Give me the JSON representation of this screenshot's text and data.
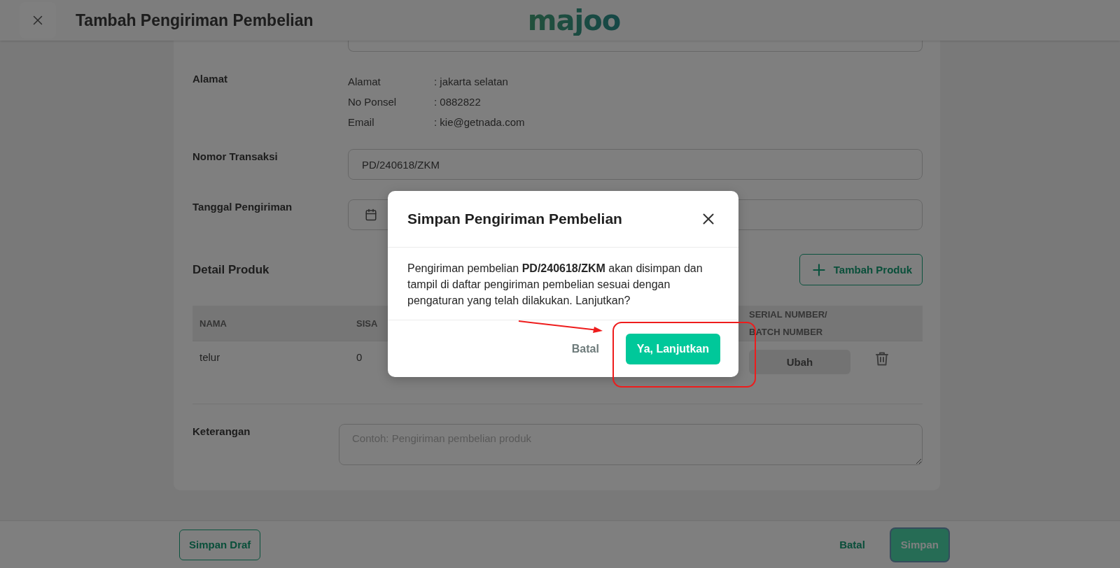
{
  "header": {
    "title": "Tambah Pengiriman Pembelian",
    "logo": "majoo"
  },
  "form": {
    "rows": [
      {
        "kind": "info",
        "label": "Alamat",
        "lines": [
          {
            "name": "Alamat",
            "value": ": jakarta selatan"
          },
          {
            "name": "No Ponsel",
            "value": ": 0882822"
          },
          {
            "name": "Email",
            "value": ": kie@getnada.com"
          }
        ]
      },
      {
        "kind": "input",
        "label": "Nomor Transaksi",
        "value": "PD/240618/ZKM"
      },
      {
        "kind": "date",
        "label": "Tanggal Pengiriman"
      }
    ]
  },
  "products": {
    "title": "Detail Produk",
    "add_button": "Tambah Produk",
    "columns": [
      "NAMA",
      "SISA",
      "SERIAL NUMBER/ BATCH NUMBER"
    ],
    "rows": [
      {
        "cells": [
          "telur",
          "0"
        ],
        "action": {
          "label": "Ubah",
          "disabled": true
        }
      }
    ]
  },
  "notes": {
    "label": "Keterangan",
    "placeholder": "Contoh: Pengiriman pembelian produk"
  },
  "footer": {
    "draft_button": "Simpan Draf",
    "cancel_button": "Batal",
    "save_button": {
      "label": "Simpan",
      "focused": true
    }
  },
  "dialog": {
    "title": "Simpan Pengiriman Pembelian",
    "message": "Pengiriman pembelian **PD/240618/ZKM** akan disimpan dan tampil di daftar pengiriman pembelian sesuai dengan pengaturan yang telah dilakukan. Lanjutkan?",
    "cancel_button": "Batal",
    "confirm_button": "Ya, Lanjutkan"
  }
}
